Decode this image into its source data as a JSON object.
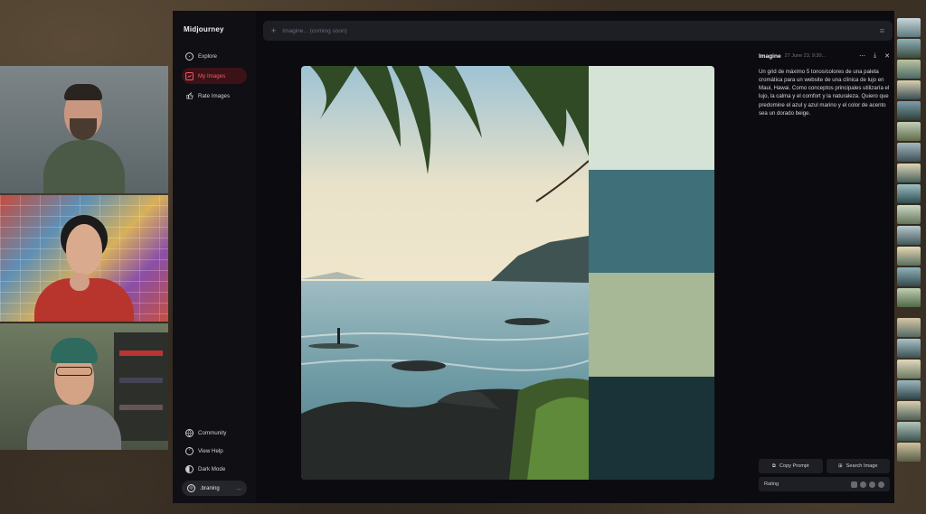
{
  "app": {
    "title": "Midjourney"
  },
  "sidebar": {
    "items": [
      {
        "label": "Explore",
        "icon": "compass-icon",
        "active": false
      },
      {
        "label": "My Images",
        "icon": "images-icon",
        "active": true
      },
      {
        "label": "Rate Images",
        "icon": "thumbs-up-icon",
        "active": false
      }
    ],
    "bottom_items": [
      {
        "label": "Community",
        "icon": "globe-icon"
      },
      {
        "label": "View Help",
        "icon": "help-icon"
      },
      {
        "label": "Dark Mode",
        "icon": "half-moon-icon"
      }
    ],
    "user": {
      "name": ".braning",
      "more": "..."
    }
  },
  "search": {
    "placeholder": "Imagine... (coming soon)"
  },
  "panel": {
    "title": "Imagine",
    "date": "27 June 23, 9:30...",
    "prompt": "Un grid de máximo 5 tonos/colores de una paleta cromática para un website de una clínica de lujo en Maui, Hawai. Como conceptos principales utilizaría el lujo, la calma y el comfort y la naturaleza. Quiero que predomine el azul y azul marino y el color de acento sea un dorado beige.",
    "copy_prompt": "Copy Prompt",
    "search_image": "Search Image",
    "rating_label": "Rating"
  },
  "palette": {
    "swatches": [
      "#d5e3d6",
      "#3f7079",
      "#a6b895",
      "#1a3338"
    ]
  },
  "colors": {
    "accent": "#f05a62",
    "window_bg": "#0c0c10",
    "sidebar_bg": "#0f0f14"
  }
}
